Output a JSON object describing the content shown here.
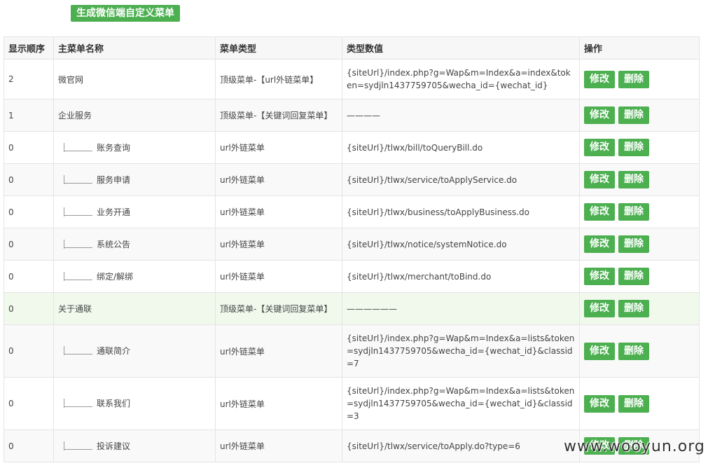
{
  "toolbar": {
    "generate_label": "生成微信端自定义菜单"
  },
  "table": {
    "headers": {
      "order": "显示顺序",
      "name": "主菜单名称",
      "type": "菜单类型",
      "value": "类型数值",
      "ops": "操作"
    },
    "edit_label": "修改",
    "delete_label": "删除",
    "rows": [
      {
        "order": "2",
        "name": "微官网",
        "type": "顶级菜单-【url外链菜单】",
        "value": "{siteUrl}/index.php?g=Wap&m=Index&a=index&token=sydjln1437759705&wecha_id={wechat_id}"
      },
      {
        "order": "1",
        "name": "企业服务",
        "type": "顶级菜单-【关键词回复菜单】",
        "value": "————"
      },
      {
        "order": "0",
        "name": "账务查询",
        "type": "url外链菜单",
        "value": "{siteUrl}/tlwx/bill/toQueryBill.do"
      },
      {
        "order": "0",
        "name": "服务申请",
        "type": "url外链菜单",
        "value": "{siteUrl}/tlwx/service/toApplyService.do"
      },
      {
        "order": "0",
        "name": "业务开通",
        "type": "url外链菜单",
        "value": "{siteUrl}/tlwx/business/toApplyBusiness.do"
      },
      {
        "order": "0",
        "name": "系统公告",
        "type": "url外链菜单",
        "value": "{siteUrl}/tlwx/notice/systemNotice.do"
      },
      {
        "order": "0",
        "name": "绑定/解绑",
        "type": "url外链菜单",
        "value": "{siteUrl}/tlwx/merchant/toBind.do"
      },
      {
        "order": "0",
        "name": "关于通联",
        "type": "顶级菜单-【关键词回复菜单】",
        "value": "——————"
      },
      {
        "order": "0",
        "name": "通联简介",
        "type": "url外链菜单",
        "value": "{siteUrl}/index.php?g=Wap&m=Index&a=lists&token=sydjln1437759705&wecha_id={wechat_id}&classid=7"
      },
      {
        "order": "0",
        "name": "联系我们",
        "type": "url外链菜单",
        "value": "{siteUrl}/index.php?g=Wap&m=Index&a=lists&token=sydjln1437759705&wecha_id={wechat_id}&classid=3"
      },
      {
        "order": "0",
        "name": "投诉建议",
        "type": "url外链菜单",
        "value": "{siteUrl}/tlwx/service/toApply.do?type=6"
      }
    ]
  },
  "watermark": "www.wooyun.org"
}
